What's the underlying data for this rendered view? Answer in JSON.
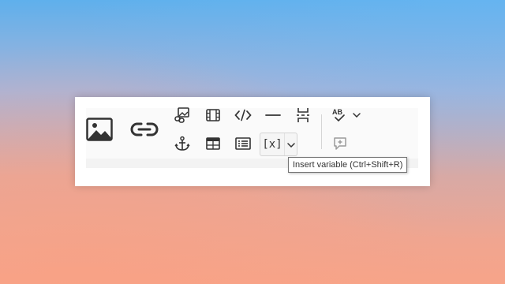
{
  "toolbar": {
    "groups": [
      {
        "items": [
          {
            "name": "insert-picture",
            "icon": "image-icon"
          },
          {
            "name": "insert-link",
            "icon": "link-icon"
          }
        ]
      },
      {
        "items": [
          {
            "name": "insert-image-link",
            "icon": "image-link-icon"
          },
          {
            "name": "insert-media",
            "icon": "film-icon"
          },
          {
            "name": "insert-code",
            "icon": "code-icon"
          },
          {
            "name": "insert-horizontal-line",
            "icon": "horizontal-line-icon"
          },
          {
            "name": "insert-page-break",
            "icon": "page-break-icon"
          },
          {
            "name": "insert-anchor",
            "icon": "anchor-icon"
          },
          {
            "name": "insert-table",
            "icon": "table-icon"
          },
          {
            "name": "insert-text-box",
            "icon": "text-box-icon"
          }
        ]
      },
      {
        "items": [
          {
            "name": "spell-check",
            "icon": "spellcheck-icon",
            "label": "AB"
          },
          {
            "name": "insert-comment",
            "icon": "comment-add-icon",
            "disabled": true
          }
        ]
      }
    ],
    "variable_button": {
      "label": "[x]",
      "icon": "variable-icon"
    }
  },
  "tooltip": {
    "text": "Insert variable (Ctrl+Shift+R)"
  },
  "colors": {
    "icon": "#333333",
    "icon_disabled": "#9a9a9a",
    "bg_top": "#5fb0ec",
    "bg_bottom": "#f7a489"
  }
}
